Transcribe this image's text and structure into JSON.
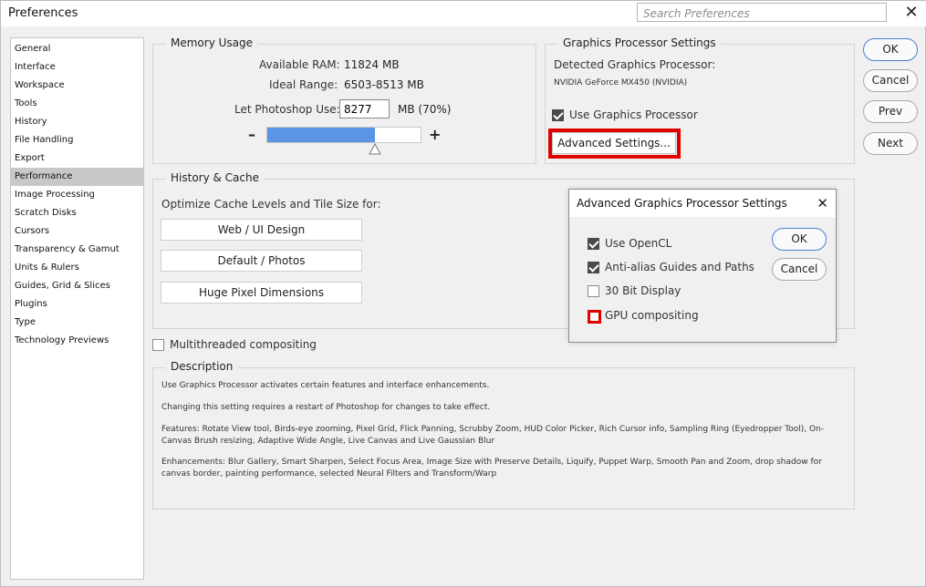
{
  "window": {
    "title": "Preferences",
    "close_glyph": "✕"
  },
  "search": {
    "placeholder": "Search Preferences"
  },
  "sidebar": {
    "items": [
      {
        "label": "General"
      },
      {
        "label": "Interface"
      },
      {
        "label": "Workspace"
      },
      {
        "label": "Tools"
      },
      {
        "label": "History"
      },
      {
        "label": "File Handling"
      },
      {
        "label": "Export"
      },
      {
        "label": "Performance",
        "selected": true
      },
      {
        "label": "Image Processing"
      },
      {
        "label": "Scratch Disks"
      },
      {
        "label": "Cursors"
      },
      {
        "label": "Transparency & Gamut"
      },
      {
        "label": "Units & Rulers"
      },
      {
        "label": "Guides, Grid & Slices"
      },
      {
        "label": "Plugins"
      },
      {
        "label": "Type"
      },
      {
        "label": "Technology Previews"
      }
    ]
  },
  "memory": {
    "title": "Memory Usage",
    "available_ram_label": "Available RAM:",
    "available_ram_value": "11824 MB",
    "ideal_range_label": "Ideal Range:",
    "ideal_range_value": "6503-8513 MB",
    "let_use_label": "Let Photoshop Use:",
    "let_use_value": "8277",
    "let_use_unit": "MB (70%)",
    "slider_fraction": 0.7,
    "minus": "–",
    "plus": "+"
  },
  "gpu": {
    "title": "Graphics Processor Settings",
    "detected_label": "Detected Graphics Processor:",
    "gpu_name": "NVIDIA GeForce MX450 (NVIDIA)",
    "use_gpu_label": "Use Graphics Processor",
    "use_gpu_checked": true,
    "advanced_button": "Advanced Settings..."
  },
  "history_cache": {
    "title": "History & Cache",
    "optimize_label": "Optimize Cache Levels and Tile Size for:",
    "buttons": [
      "Web / UI Design",
      "Default / Photos",
      "Huge Pixel Dimensions"
    ]
  },
  "multithreaded": {
    "label": "Multithreaded compositing",
    "checked": false
  },
  "description": {
    "title": "Description",
    "paragraphs": [
      "Use Graphics Processor activates certain features and interface enhancements.",
      "Changing this setting requires a restart of Photoshop for changes to take effect.",
      "Features: Rotate View tool, Birds-eye zooming, Pixel Grid, Flick Panning, Scrubby Zoom, HUD Color Picker, Rich Cursor info, Sampling Ring (Eyedropper Tool), On-Canvas Brush resizing, Adaptive Wide Angle, Live Canvas and Live Gaussian Blur",
      "Enhancements: Blur Gallery, Smart Sharpen, Select Focus Area, Image Size with Preserve Details, Liquify, Puppet Warp, Smooth Pan and Zoom, drop shadow for canvas border, painting performance, selected Neural Filters and Transform/Warp"
    ]
  },
  "actions": {
    "ok": "OK",
    "cancel": "Cancel",
    "prev": "Prev",
    "next": "Next"
  },
  "advanced_dialog": {
    "title": "Advanced Graphics Processor Settings",
    "close_glyph": "✕",
    "options": [
      {
        "label": "Use OpenCL",
        "checked": true
      },
      {
        "label": "Anti-alias Guides and Paths",
        "checked": true
      },
      {
        "label": "30 Bit Display",
        "checked": false
      },
      {
        "label": "GPU compositing",
        "checked": false
      }
    ],
    "ok": "OK",
    "cancel": "Cancel"
  },
  "colors": {
    "accent": "#5b96e6",
    "highlight_red": "#e00000",
    "selected_row": "#c8c8c8"
  }
}
